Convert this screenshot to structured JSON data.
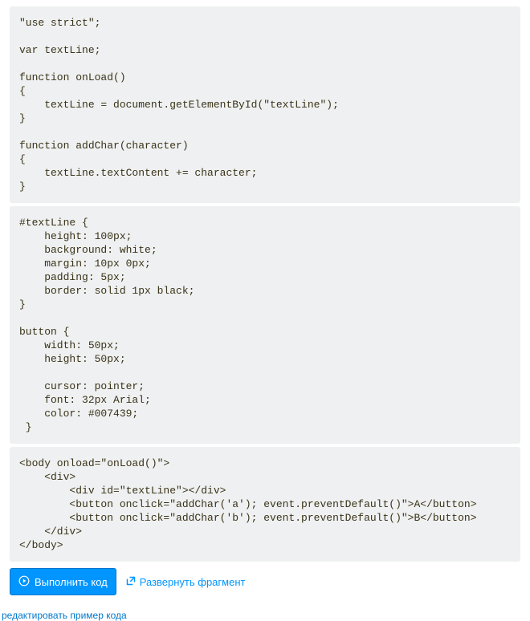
{
  "code_blocks": {
    "js": "\"use strict\";\n\nvar textLine;\n\nfunction onLoad()\n{\n    textLine = document.getElementById(\"textLine\");\n}\n\nfunction addChar(character)\n{\n    textLine.textContent += character;\n}",
    "css": "#textLine {\n    height: 100px;\n    background: white;\n    margin: 10px 0px;\n    padding: 5px;\n    border: solid 1px black;\n}\n\nbutton {\n    width: 50px;\n    height: 50px;\n    \n    cursor: pointer;\n    font: 32px Arial;\n    color: #007439;\n }",
    "html": "<body onload=\"onLoad()\">\n    <div>\n        <div id=\"textLine\"></div>\n        <button onclick=\"addChar('a'); event.preventDefault()\">A</button>\n        <button onclick=\"addChar('b'); event.preventDefault()\">B</button>\n    </div>\n</body>"
  },
  "buttons": {
    "run_label": "Выполнить код",
    "expand_label": "Развернуть фрагмент"
  },
  "links": {
    "edit_label": "редактировать пример кода"
  }
}
